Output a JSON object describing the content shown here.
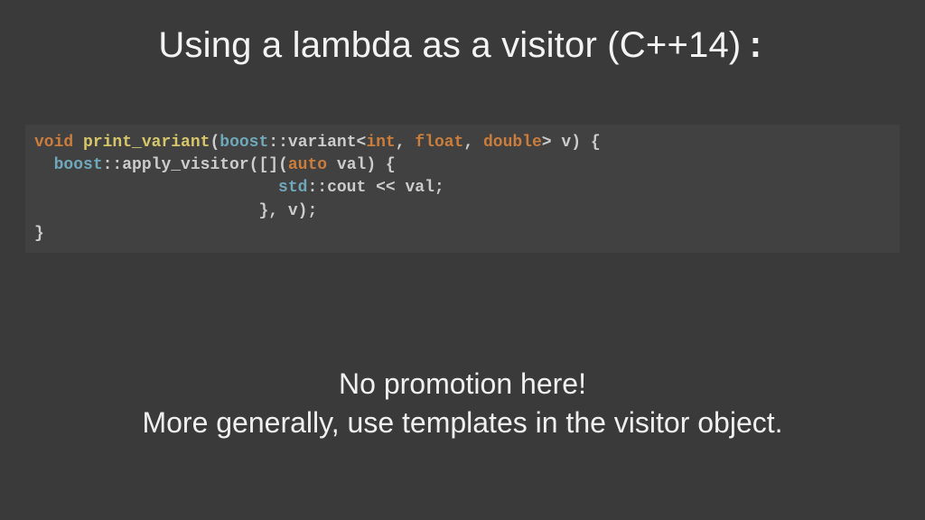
{
  "title_main": "Using a lambda as a visitor (C++14)",
  "title_colon": ":",
  "code": {
    "l1": {
      "kw_void": "void",
      "sp1": " ",
      "fn": "print_variant",
      "p_open": "(",
      "ns_boost": "boost",
      "p_scope1": "::",
      "id_variant": "variant<",
      "kw_int": "int",
      "p_comma1": ", ",
      "kw_float": "float",
      "p_comma2": ", ",
      "kw_double": "double",
      "p_close1": ">",
      "sp2": " ",
      "id_v": "v",
      "p_close2": ") {"
    },
    "l2": {
      "indent": "  ",
      "ns_boost": "boost",
      "p_scope": "::",
      "id_apply": "apply_visitor([](",
      "kw_auto": "auto",
      "sp": " ",
      "id_val": "val",
      "p_close": ") {"
    },
    "l3": {
      "indent": "                         ",
      "ns_std": "std",
      "p_scope": "::",
      "id_cout": "cout << val;"
    },
    "l4": {
      "indent": "                       ",
      "p_close": "}, v);"
    },
    "l5": {
      "p_close": "}"
    }
  },
  "bottom": {
    "line1": "No promotion here!",
    "line2": "More generally, use templates in the visitor object."
  }
}
